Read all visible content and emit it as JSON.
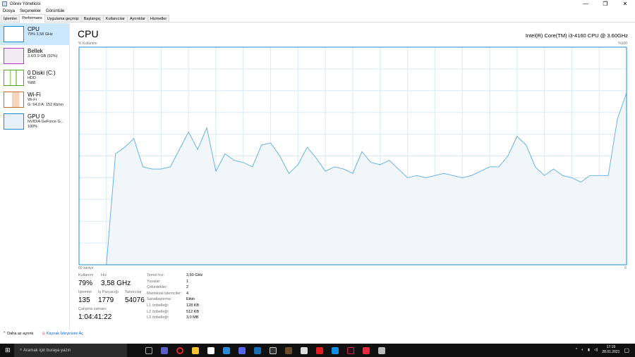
{
  "window": {
    "title": "Görev Yöneticisi",
    "minimize": "—",
    "maximize": "❐",
    "close": "✕"
  },
  "menu": [
    "Dosya",
    "Seçenekler",
    "Görüntüle"
  ],
  "tabs": [
    "İşlemler",
    "Performans",
    "Uygulama geçmişi",
    "Başlangıç",
    "Kullanıcılar",
    "Ayrıntılar",
    "Hizmetler"
  ],
  "sidebar": [
    {
      "name": "CPU",
      "l1": "79% 3,58 GHz",
      "l2": "",
      "l3": "",
      "color": "#1a8ad4"
    },
    {
      "name": "Bellek",
      "l1": "3,6/3,9 GB (92%)",
      "l2": "",
      "l3": "",
      "color": "#b03cc8"
    },
    {
      "name": "0 Diski (C:)",
      "l1": "HDD",
      "l2": "%88",
      "l3": "",
      "color": "#4daa1f"
    },
    {
      "name": "Wi-Fi",
      "l1": "Wi-Fi",
      "l2": "G: 64,0 A: 152 Kb/sn",
      "l3": "",
      "color": "#c86d2a"
    },
    {
      "name": "GPU 0",
      "l1": "NVIDIA GeForce G...",
      "l2": "100%",
      "l3": "",
      "color": "#1a8ad4"
    }
  ],
  "main": {
    "title": "CPU",
    "model": "Intel(R) Core(TM) i3-4160 CPU @ 3.60GHz",
    "ylabel": "% Kullanımı",
    "ymax": "%100",
    "xleft": "60 saniye",
    "xright": "0"
  },
  "stats": {
    "usage_label": "Kullanım",
    "usage": "79%",
    "speed_label": "Hız",
    "speed": "3,58 GHz",
    "proc_label": "İşlemler",
    "proc": "135",
    "threads_label": "İş Parçacığı",
    "threads": "1779",
    "handles_label": "Tanıtıcılar",
    "handles": "54076",
    "uptime_label": "Çalışma zamanı",
    "uptime": "1:04:41:22",
    "specs": [
      [
        "Temel hız:",
        "3,60 GHz"
      ],
      [
        "Yuvalar:",
        "1"
      ],
      [
        "Çekirdekler:",
        "2"
      ],
      [
        "Mantıksal işlemciler:",
        "4"
      ],
      [
        "Sanallaştırma:",
        "Etkin"
      ],
      [
        "L1 önbelleği:",
        "128 KB"
      ],
      [
        "L2 önbelleği:",
        "512 KB"
      ],
      [
        "L3 önbelleği:",
        "3,0 MB"
      ]
    ]
  },
  "footer": {
    "less": "Daha az ayrıntı",
    "monitor": "Kaynak İzleyicisini Aç"
  },
  "taskbar": {
    "search": "Aramak için buraya yazın",
    "time": "17:19",
    "date": "28.01.2021"
  },
  "chart_data": {
    "type": "area",
    "title": "CPU",
    "ylabel": "% Kullanımı",
    "xlabel": "60 saniye",
    "ylim": [
      0,
      100
    ],
    "xlim": [
      60,
      0
    ],
    "grid": true,
    "values": [
      0,
      0,
      0,
      0,
      51,
      54,
      58,
      45,
      44,
      44,
      45,
      53,
      61,
      53,
      63,
      43,
      51,
      48,
      47,
      45,
      55,
      56,
      50,
      42,
      46,
      54,
      49,
      43,
      45,
      44,
      42,
      52,
      47,
      46,
      48,
      44,
      40,
      41,
      40,
      41,
      42,
      41,
      40,
      41,
      43,
      45,
      45,
      50,
      59,
      55,
      45,
      41,
      44,
      41,
      40,
      38,
      41,
      41,
      41,
      67,
      79
    ]
  }
}
